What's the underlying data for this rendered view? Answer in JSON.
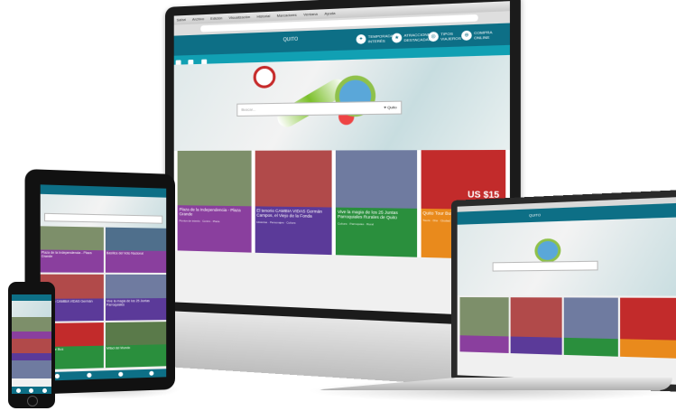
{
  "browser": {
    "menu": [
      "Safari",
      "Archivo",
      "Edición",
      "Visualización",
      "Historial",
      "Marcadores",
      "Ventana",
      "Ayuda"
    ]
  },
  "site": {
    "logo_text": "QUITO",
    "header_items": [
      {
        "label": "TEMPORADAS",
        "sub": "INTERÉS",
        "icon": "ticket-icon"
      },
      {
        "label": "ATRACCIONES",
        "sub": "DESTACADAS",
        "icon": "star-icon"
      },
      {
        "label": "TIPOS",
        "sub": "VIAJEROS",
        "icon": "compass-icon"
      },
      {
        "label": "COMPRA",
        "sub": "ONLINE",
        "icon": "cart-icon"
      }
    ],
    "search_placeholder": "Buscar...",
    "location": "Quito",
    "cards": [
      {
        "title": "Plaza de la Independencia - Plaza Grande",
        "meta": "Puntos de interés · Centro · Plaza",
        "color": "#8a3f9e",
        "img": "#7d8f6a"
      },
      {
        "title": "El tenorio CAMBIA VIDAS Germán Campos, el Viejo de la Fonda",
        "meta": "Historias · Personajes · Cultura",
        "color": "#5b3a99",
        "img": "#b14a4a"
      },
      {
        "title": "Vive la magia de los 25 Juntas Parroquiales Rurales de Quito",
        "meta": "Cultura · Parroquias · Rural",
        "color": "#2a8f3d",
        "img": "#6f7ba0"
      },
      {
        "title": "Quito Tour Bus - 1 día",
        "meta": "Tours · Día · Ciudad",
        "color": "#e98a1c",
        "img": "#c22b2b",
        "price": "US $15"
      }
    ]
  },
  "tablet": {
    "cells": [
      {
        "title": "Plaza de la Independencia - Plaza Grande",
        "color": "#8a3f9e"
      },
      {
        "title": "Basílica del Voto Nacional",
        "color": "#8a3f9e"
      },
      {
        "title": "El tenorio CAMBIA VIDAS Germán Campos",
        "color": "#5b3a99"
      },
      {
        "title": "Vive la magia de los 25 Juntas Parroquiales",
        "color": "#5b3a99"
      },
      {
        "title": "Quito Tour Bus",
        "color": "#2a8f3d"
      },
      {
        "title": "Mitad del Mundo",
        "color": "#2a8f3d"
      }
    ]
  },
  "colors": {
    "primary": "#0d6f86",
    "accent": "#11a0b3"
  }
}
